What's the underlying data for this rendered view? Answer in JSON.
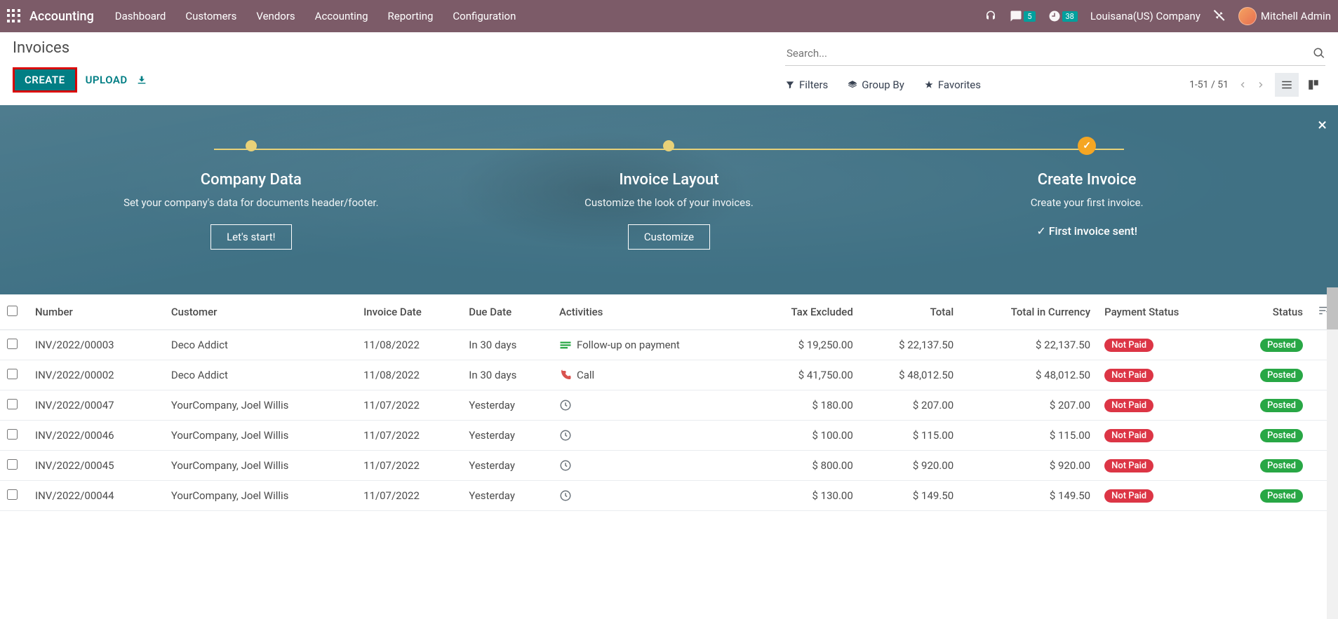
{
  "top": {
    "app_name": "Accounting",
    "menu": [
      "Dashboard",
      "Customers",
      "Vendors",
      "Accounting",
      "Reporting",
      "Configuration"
    ],
    "msg_badge": "5",
    "act_badge": "38",
    "company": "Louisana(US) Company",
    "user": "Mitchell Admin"
  },
  "sub": {
    "breadcrumb": "Invoices",
    "create": "CREATE",
    "upload": "UPLOAD",
    "search_placeholder": "Search...",
    "filters": "Filters",
    "groupby": "Group By",
    "favorites": "Favorites",
    "pager": "1-51 / 51"
  },
  "banner": {
    "steps": [
      {
        "title": "Company Data",
        "desc": "Set your company's data for documents header/footer.",
        "btn": "Let's start!"
      },
      {
        "title": "Invoice Layout",
        "desc": "Customize the look of your invoices.",
        "btn": "Customize"
      },
      {
        "title": "Create Invoice",
        "desc": "Create your first invoice.",
        "done": "First invoice sent!"
      }
    ]
  },
  "cols": {
    "number": "Number",
    "customer": "Customer",
    "inv_date": "Invoice Date",
    "due_date": "Due Date",
    "activities": "Activities",
    "tax_ex": "Tax Excluded",
    "total": "Total",
    "total_cur": "Total in Currency",
    "pay_status": "Payment Status",
    "status": "Status"
  },
  "rows": [
    {
      "number": "INV/2022/00003",
      "customer": "Deco Addict",
      "inv_date": "11/08/2022",
      "due_date": "In 30 days",
      "overdue": false,
      "activity_icon": "followup",
      "activity": "Follow-up on payment",
      "tax": "$ 19,250.00",
      "total": "$ 22,137.50",
      "totalc": "$ 22,137.50",
      "pay": "Not Paid",
      "status": "Posted"
    },
    {
      "number": "INV/2022/00002",
      "customer": "Deco Addict",
      "inv_date": "11/08/2022",
      "due_date": "In 30 days",
      "overdue": false,
      "activity_icon": "call",
      "activity": "Call",
      "tax": "$ 41,750.00",
      "total": "$ 48,012.50",
      "totalc": "$ 48,012.50",
      "pay": "Not Paid",
      "status": "Posted"
    },
    {
      "number": "INV/2022/00047",
      "customer": "YourCompany, Joel Willis",
      "inv_date": "11/07/2022",
      "due_date": "Yesterday",
      "overdue": true,
      "activity_icon": "clock",
      "activity": "",
      "tax": "$ 180.00",
      "total": "$ 207.00",
      "totalc": "$ 207.00",
      "pay": "Not Paid",
      "status": "Posted"
    },
    {
      "number": "INV/2022/00046",
      "customer": "YourCompany, Joel Willis",
      "inv_date": "11/07/2022",
      "due_date": "Yesterday",
      "overdue": true,
      "activity_icon": "clock",
      "activity": "",
      "tax": "$ 100.00",
      "total": "$ 115.00",
      "totalc": "$ 115.00",
      "pay": "Not Paid",
      "status": "Posted"
    },
    {
      "number": "INV/2022/00045",
      "customer": "YourCompany, Joel Willis",
      "inv_date": "11/07/2022",
      "due_date": "Yesterday",
      "overdue": true,
      "activity_icon": "clock",
      "activity": "",
      "tax": "$ 800.00",
      "total": "$ 920.00",
      "totalc": "$ 920.00",
      "pay": "Not Paid",
      "status": "Posted"
    },
    {
      "number": "INV/2022/00044",
      "customer": "YourCompany, Joel Willis",
      "inv_date": "11/07/2022",
      "due_date": "Yesterday",
      "overdue": true,
      "activity_icon": "clock",
      "activity": "",
      "tax": "$ 130.00",
      "total": "$ 149.50",
      "totalc": "$ 149.50",
      "pay": "Not Paid",
      "status": "Posted"
    }
  ]
}
